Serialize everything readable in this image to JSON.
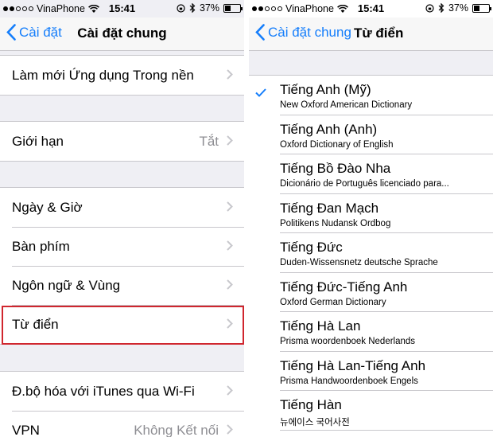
{
  "status": {
    "carrier": "VinaPhone",
    "time": "15:41",
    "battery": "37%"
  },
  "left": {
    "back_label": "Cài đặt",
    "title": "Cài đặt chung",
    "rows": [
      {
        "label": "Làm mới Ứng dụng Trong nền",
        "value": ""
      },
      {
        "label": "Giới hạn",
        "value": "Tắt"
      },
      {
        "label": "Ngày & Giờ",
        "value": ""
      },
      {
        "label": "Bàn phím",
        "value": ""
      },
      {
        "label": "Ngôn ngữ & Vùng",
        "value": ""
      },
      {
        "label": "Từ điển",
        "value": ""
      },
      {
        "label": "Đ.bộ hóa với iTunes qua Wi-Fi",
        "value": ""
      },
      {
        "label": "VPN",
        "value": "Không Kết nối"
      }
    ]
  },
  "right": {
    "back_label": "Cài đặt chung",
    "title": "Từ điển",
    "dictionaries": [
      {
        "name": "Tiếng Anh (Mỹ)",
        "source": "New Oxford American Dictionary",
        "checked": true
      },
      {
        "name": "Tiếng Anh (Anh)",
        "source": "Oxford Dictionary of English",
        "checked": false
      },
      {
        "name": "Tiếng Bồ Đào Nha",
        "source": "Dicionário de Português licenciado para...",
        "checked": false
      },
      {
        "name": "Tiếng Đan Mạch",
        "source": "Politikens Nudansk Ordbog",
        "checked": false
      },
      {
        "name": "Tiếng Đức",
        "source": "Duden-Wissensnetz deutsche Sprache",
        "checked": false
      },
      {
        "name": "Tiếng Đức-Tiếng Anh",
        "source": "Oxford German Dictionary",
        "checked": false
      },
      {
        "name": "Tiếng Hà Lan",
        "source": "Prisma woordenboek Nederlands",
        "checked": false
      },
      {
        "name": "Tiếng Hà Lan-Tiếng Anh",
        "source": "Prisma Handwoordenboek Engels",
        "checked": false
      },
      {
        "name": "Tiếng Hàn",
        "source": "뉴에이스 국어사전",
        "checked": false
      }
    ]
  },
  "colors": {
    "accent": "#157efb",
    "highlight": "#d0262e",
    "background": "#efeff4"
  }
}
